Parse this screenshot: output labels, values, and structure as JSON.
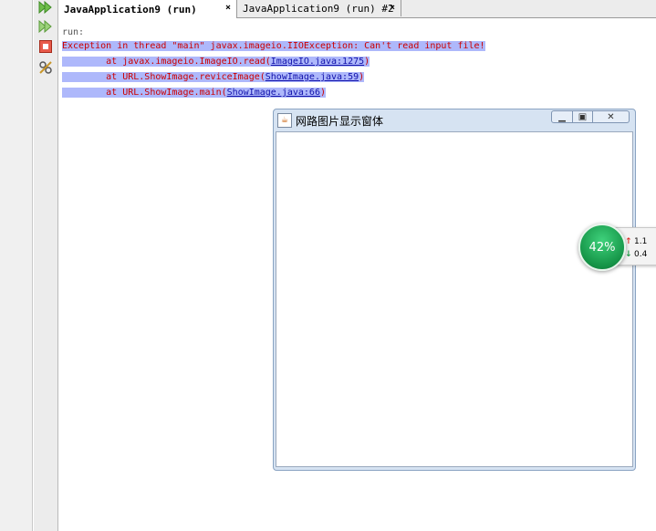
{
  "tabs": [
    {
      "label": "JavaApplication9 (run)",
      "close": "×",
      "active": true
    },
    {
      "label": "JavaApplication9 (run) #2",
      "close": "×",
      "active": false
    }
  ],
  "console": {
    "run_label": "run:",
    "exception_line": "Exception in thread \"main\" javax.imageio.IIOException: Can't read input file!",
    "stack": [
      {
        "prefix": "        at javax.imageio.ImageIO.read(",
        "link": "ImageIO.java:1275",
        "suffix": ")"
      },
      {
        "prefix": "        at URL.ShowImage.reviceImage(",
        "link": "ShowImage.java:59",
        "suffix": ")"
      },
      {
        "prefix": "        at URL.ShowImage.main(",
        "link": "ShowImage.java:66",
        "suffix": ")"
      }
    ]
  },
  "window": {
    "title": "网路图片显示窗体"
  },
  "gadget": {
    "percent": "42%",
    "up_value": "1.1",
    "down_value": "0.4",
    "accent": "#1fae55"
  },
  "icons": {
    "rerun": "double-play-icon",
    "rerun_modified": "double-play-icon",
    "stop": "stop-icon",
    "settings": "tools-icon"
  }
}
